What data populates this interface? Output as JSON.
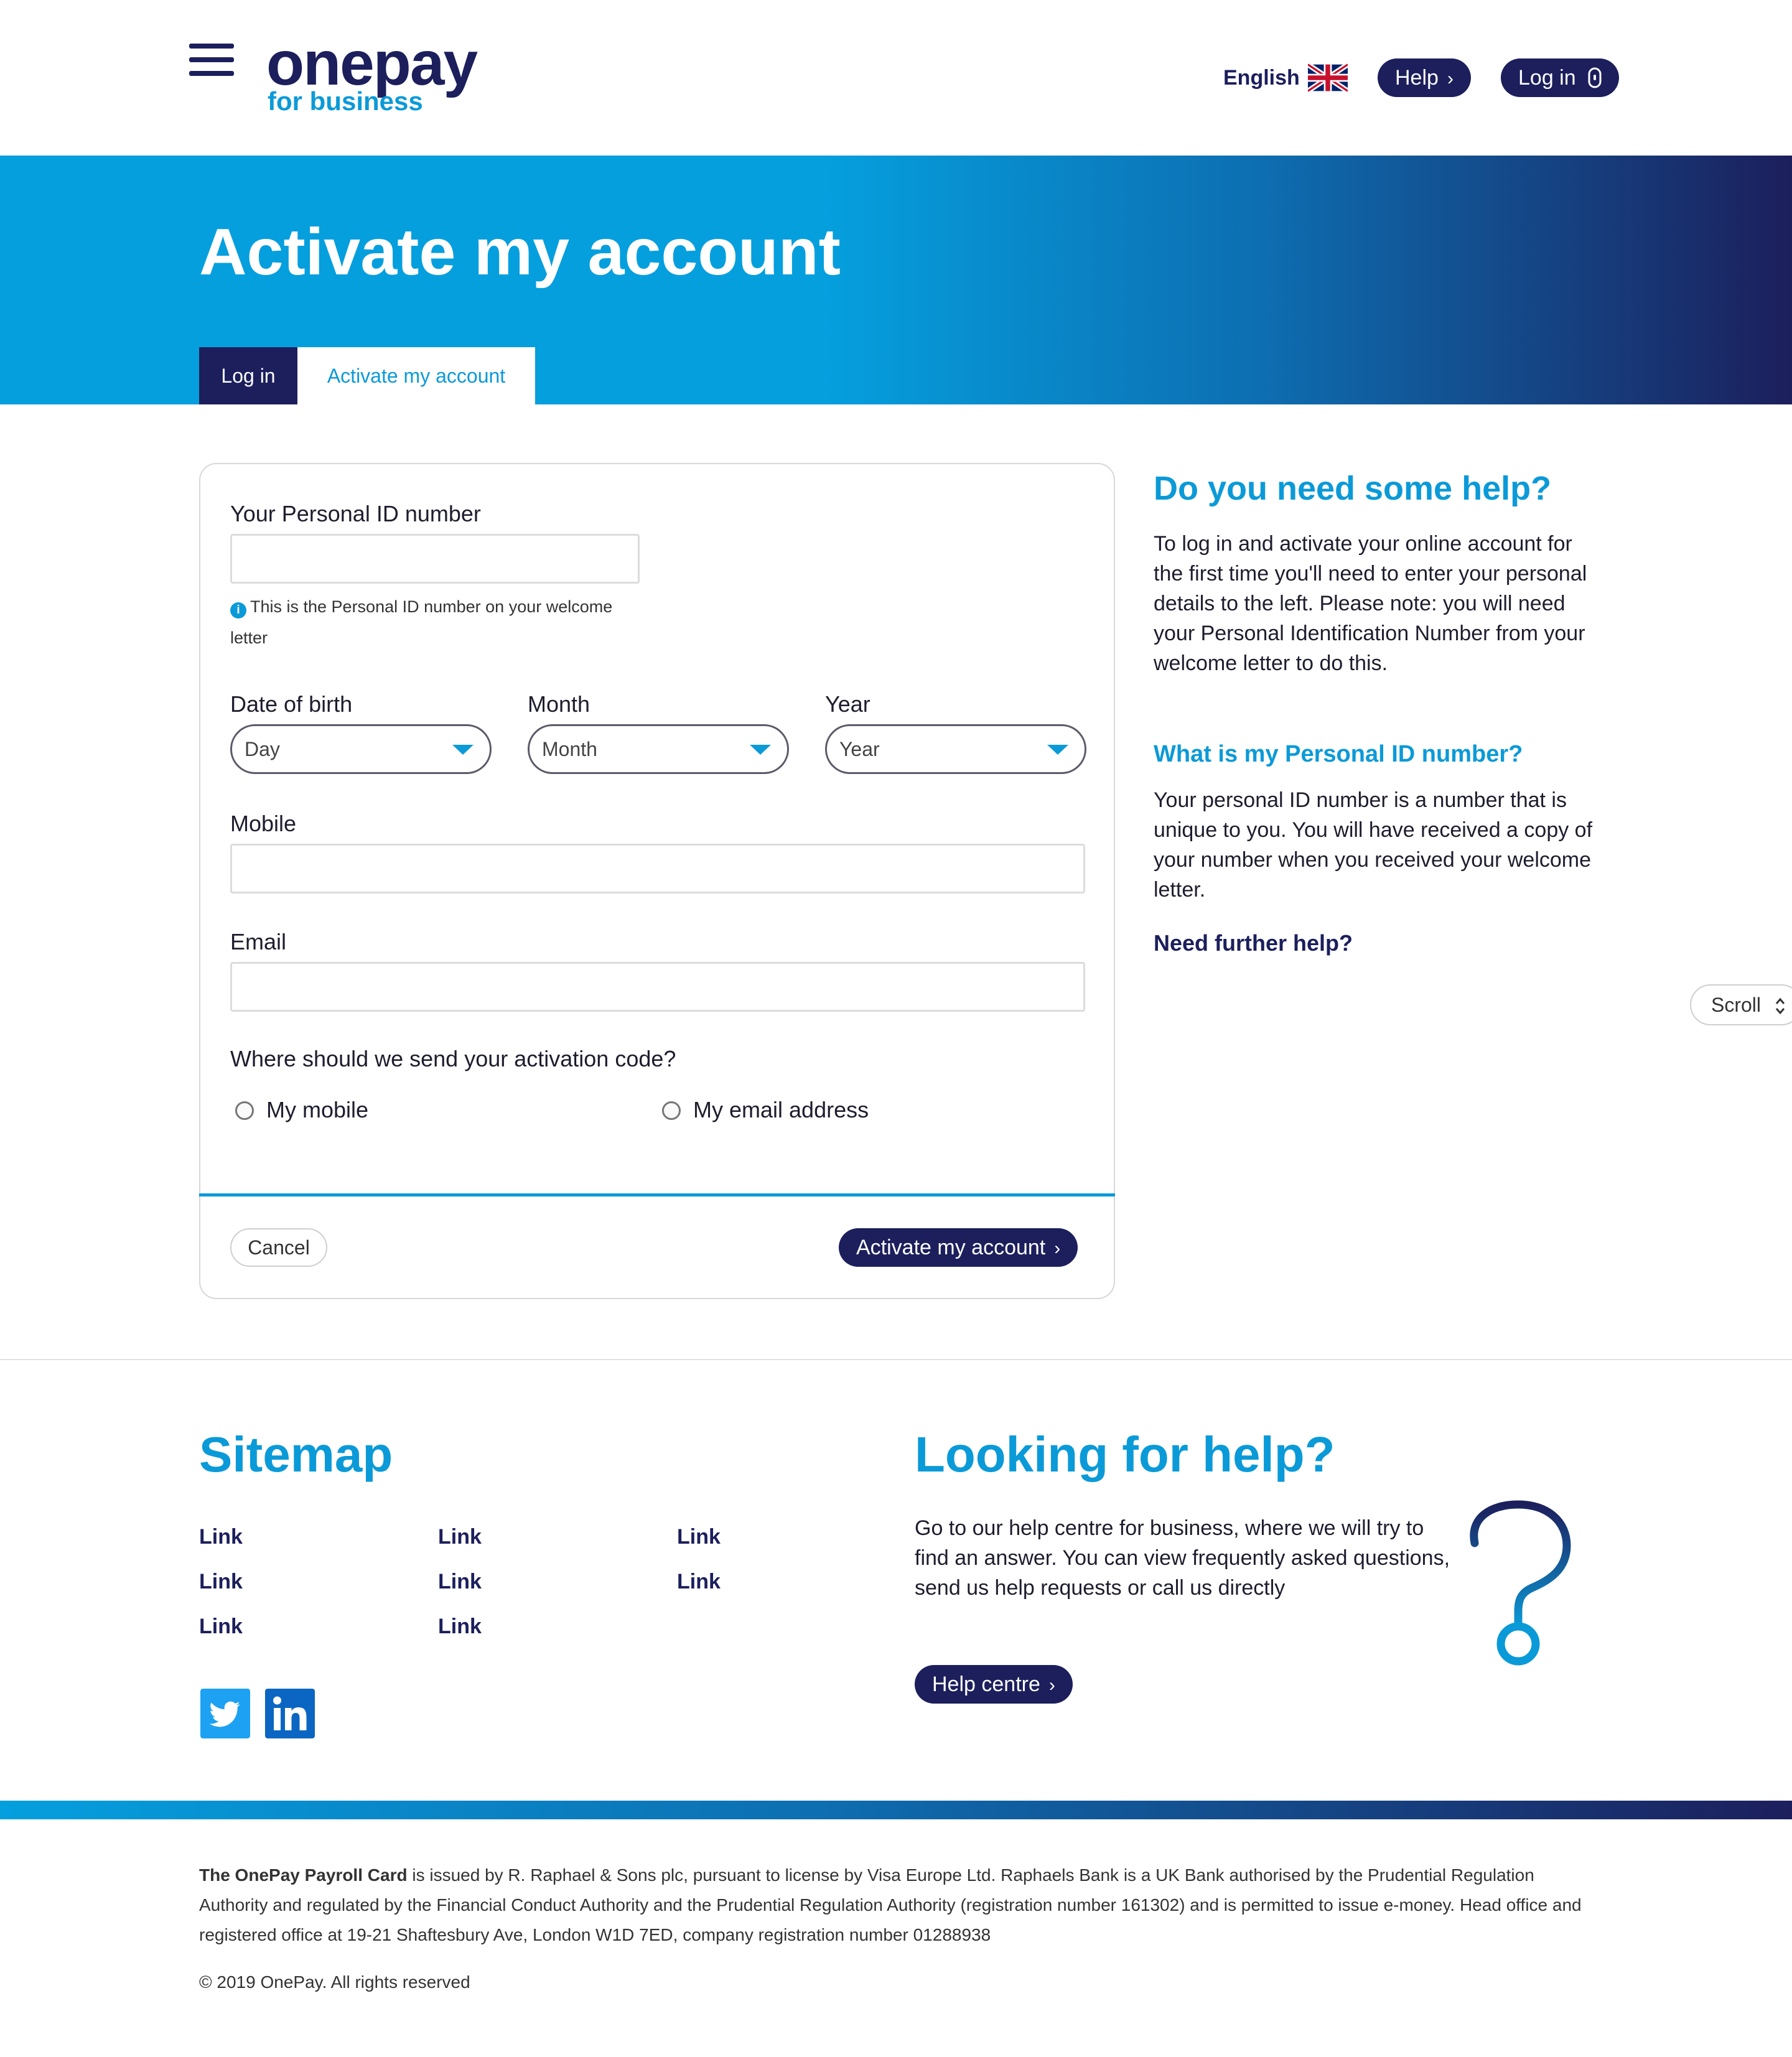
{
  "header": {
    "logo_word": "onepay",
    "logo_sub": "for business",
    "language": "English",
    "help_label": "Help",
    "login_label": "Log in"
  },
  "hero": {
    "title": "Activate my account",
    "tabs": [
      {
        "label": "Log in",
        "active": false
      },
      {
        "label": "Activate my account",
        "active": true
      }
    ]
  },
  "form": {
    "pin_label": "Your Personal ID number",
    "pin_value": "",
    "pin_hint": "This is the Personal ID number on your welcome letter",
    "dob_label": "Date of birth",
    "month_label": "Month",
    "year_label": "Year",
    "day_select": "Day",
    "month_select": "Month",
    "year_select": "Year",
    "mobile_label": "Mobile",
    "mobile_value": "",
    "email_label": "Email",
    "email_value": "",
    "send_question": "Where should we send your activation code?",
    "option_mobile": "My mobile",
    "option_email": "My email address",
    "cancel_label": "Cancel",
    "submit_label": "Activate my account"
  },
  "sidebar": {
    "heading": "Do you need some help?",
    "intro": "To log in and activate your online account for the first time you'll need to enter your personal details to the left. Please note: you will need your Personal Identification Number from your welcome letter to do this.",
    "sub_heading": "What is my Personal ID number?",
    "sub_text": "Your personal ID number is a number that is unique to you. You will have received a copy of your number when you received your welcome letter.",
    "further_help": "Need further help?",
    "scroll_label": "Scroll"
  },
  "footer": {
    "sitemap_heading": "Sitemap",
    "links": [
      [
        "Link",
        "Link",
        "Link"
      ],
      [
        "Link",
        "Link",
        "Link"
      ],
      [
        "Link",
        "Link"
      ]
    ],
    "help_heading": "Looking for help?",
    "help_text": "Go to our help centre for business, where we will try to find an answer. You can view frequently asked questions, send us help requests or call us directly",
    "help_button": "Help centre",
    "legal_bold": "The OnePay Payroll Card",
    "legal_text": " is issued by R. Raphael & Sons plc, pursuant to license by Visa Europe Ltd. Raphaels Bank is a UK Bank authorised by the Prudential Regulation Authority and regulated by the Financial Conduct Authority and the Prudential Regulation Authority (registration number 161302) and is permitted to issue e-money. Head office and registered office at 19-21 Shaftesbury Ave, London W1D 7ED, company registration number 01288938",
    "copyright": "© 2019 OnePay. All rights reserved"
  },
  "colors": {
    "navy": "#1c1f5c",
    "brand_blue": "#0b9ad8",
    "twitter": "#1da1f2",
    "linkedin": "#0a66c2"
  }
}
